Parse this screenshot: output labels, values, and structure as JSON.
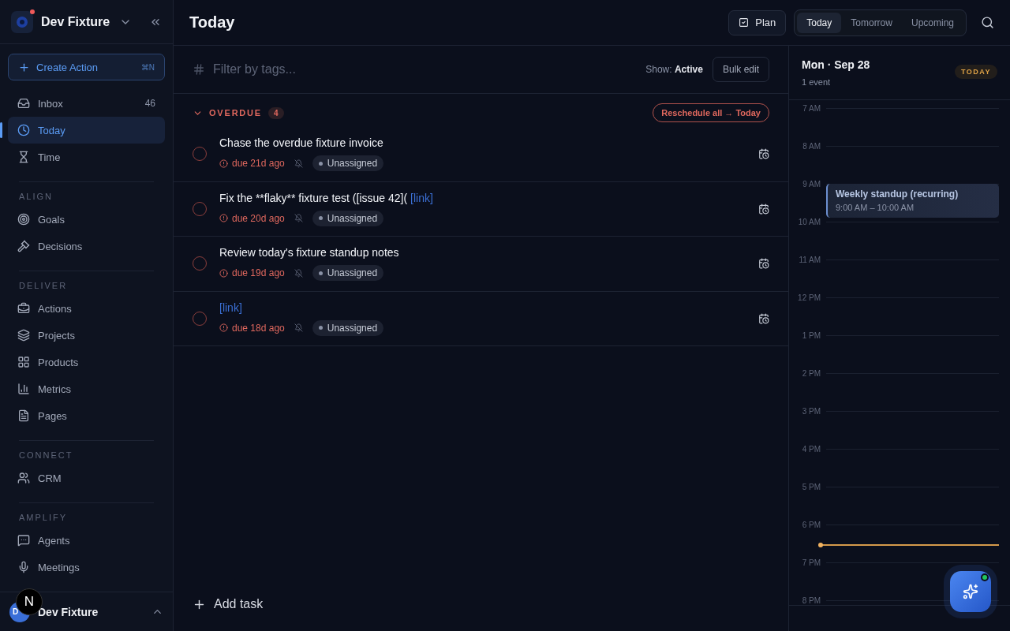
{
  "workspace": {
    "name": "Dev Fixture",
    "notification": true
  },
  "create_action": {
    "label": "Create Action",
    "shortcut": "⌘N"
  },
  "nav": [
    {
      "label": "Inbox",
      "count": "46",
      "selected": false
    },
    {
      "label": "Today",
      "selected": true
    },
    {
      "label": "Time",
      "selected": false
    }
  ],
  "sections": [
    {
      "label": "ALIGN",
      "items": [
        {
          "label": "Goals",
          "selected": false
        },
        {
          "label": "Decisions",
          "selected": false
        }
      ]
    },
    {
      "label": "DELIVER",
      "items": [
        {
          "label": "Actions",
          "selected": false
        },
        {
          "label": "Projects",
          "selected": false
        },
        {
          "label": "Products",
          "selected": false
        },
        {
          "label": "Metrics",
          "selected": false
        },
        {
          "label": "Pages",
          "selected": false
        }
      ]
    },
    {
      "label": "CONNECT",
      "items": [
        {
          "label": "CRM",
          "selected": false
        }
      ]
    },
    {
      "label": "AMPLIFY",
      "items": [
        {
          "label": "Agents",
          "selected": false
        },
        {
          "label": "Meetings",
          "selected": false
        }
      ]
    }
  ],
  "profile": {
    "initials": "D",
    "name": "Dev Fixture",
    "dev_badge": "N"
  },
  "header": {
    "title": "Today",
    "plan_button": "Plan",
    "tabs": [
      {
        "label": "Today",
        "selected": true
      },
      {
        "label": "Tomorrow",
        "selected": false
      },
      {
        "label": "Upcoming",
        "selected": false
      }
    ]
  },
  "filter": {
    "placeholder": "Filter by tags...",
    "show_label": "Show:",
    "show_value": "Active",
    "bulk_edit": "Bulk edit"
  },
  "group": {
    "label": "OVERDUE",
    "count": "4",
    "expanded": true,
    "action": "Reschedule all → Today"
  },
  "tasks": [
    {
      "title": "Chase the overdue fixture invoice",
      "due": "due 21d ago",
      "assignee": "Unassigned",
      "checked": false
    },
    {
      "title": "Fix the **flaky** fixture test ([issue 42](",
      "link": "[link]",
      "due": "due 20d ago",
      "assignee": "Unassigned",
      "checked": false
    },
    {
      "title": "Review today's fixture standup notes",
      "due": "due 19d ago",
      "assignee": "Unassigned",
      "checked": false
    },
    {
      "link": "[link]",
      "due": "due 18d ago",
      "assignee": "Unassigned",
      "checked": false
    }
  ],
  "add_task": "Add task",
  "calendar": {
    "date": "Mon · Sep 28",
    "events_count": "1 event",
    "badge": "TODAY",
    "hours": [
      {
        "label": "7 AM"
      },
      {
        "label": "8 AM"
      },
      {
        "label": "9 AM",
        "events": [
          {
            "title": "Weekly standup (recurring)",
            "time": "9:00 AM – 10:00 AM"
          }
        ]
      },
      {
        "label": "10 AM"
      },
      {
        "label": "11 AM"
      },
      {
        "label": "12 PM"
      },
      {
        "label": "1 PM"
      },
      {
        "label": "2 PM"
      },
      {
        "label": "3 PM"
      },
      {
        "label": "4 PM"
      },
      {
        "label": "5 PM"
      },
      {
        "label": "6 PM",
        "now": true
      },
      {
        "label": "7 PM"
      },
      {
        "label": "8 PM"
      }
    ]
  },
  "assistant": {
    "online": true
  }
}
